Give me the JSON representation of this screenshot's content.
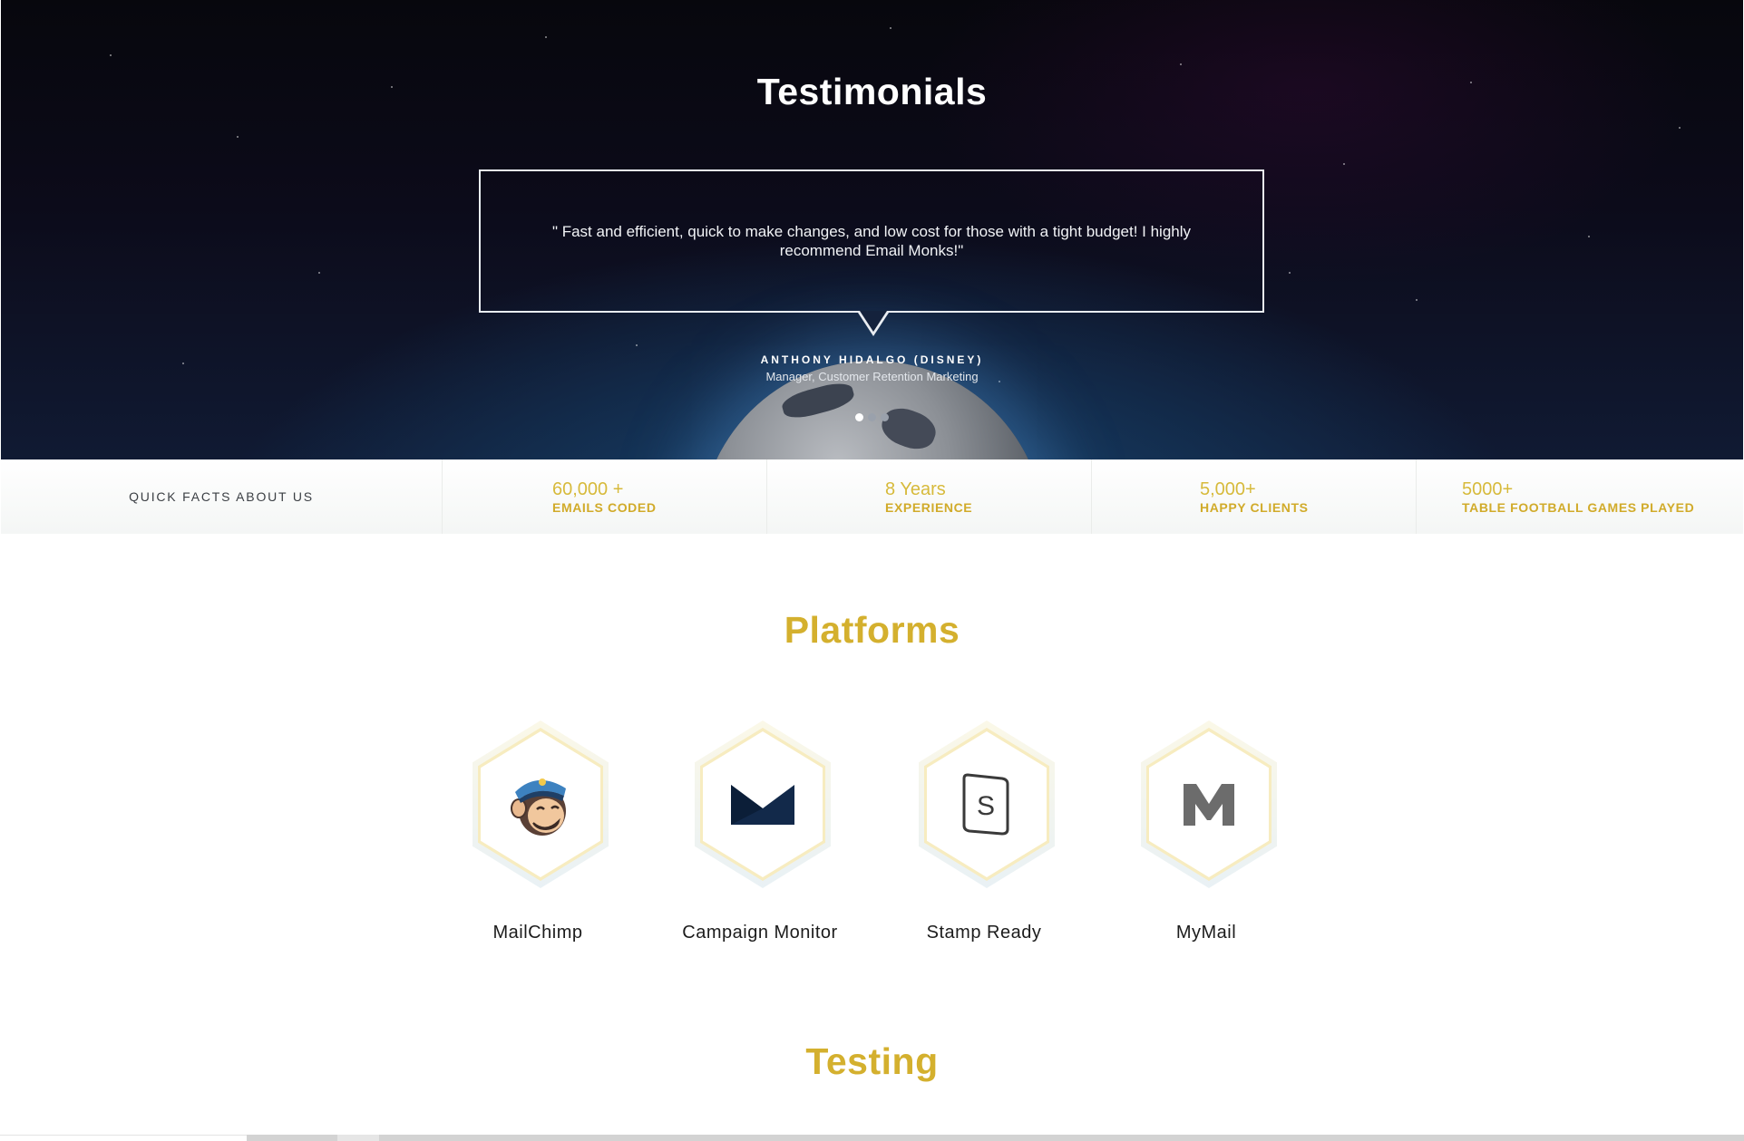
{
  "testimonials": {
    "title": "Testimonials",
    "quote": "\" Fast and efficient, quick to make changes, and low cost for those with a tight budget! I highly recommend Email Monks!\"",
    "author": "ANTHONY HIDALGO (DISNEY)",
    "role": "Manager, Customer Retention Marketing",
    "active_slide": 1,
    "slide_count": 3
  },
  "facts": {
    "intro": "QUICK FACTS ABOUT US",
    "items": [
      {
        "value": "60,000 +",
        "label": "EMAILS CODED"
      },
      {
        "value": "8 Years",
        "label": "EXPERIENCE"
      },
      {
        "value": "5,000+",
        "label": "HAPPY CLIENTS"
      },
      {
        "value": "5000+",
        "label": "TABLE FOOTBALL GAMES PLAYED"
      }
    ]
  },
  "platforms": {
    "title": "Platforms",
    "items": [
      {
        "name": "MailChimp",
        "icon": "mailchimp-logo-icon"
      },
      {
        "name": "Campaign Monitor",
        "icon": "campaign-monitor-logo-icon"
      },
      {
        "name": "Stamp Ready",
        "icon": "stampready-logo-icon"
      },
      {
        "name": "MyMail",
        "icon": "mymail-logo-icon"
      }
    ]
  },
  "testing": {
    "title": "Testing"
  },
  "colors": {
    "gold": "#d4b02e",
    "fact_gold": "#d7ba3b",
    "hero_bg": "#0c0b1a"
  }
}
